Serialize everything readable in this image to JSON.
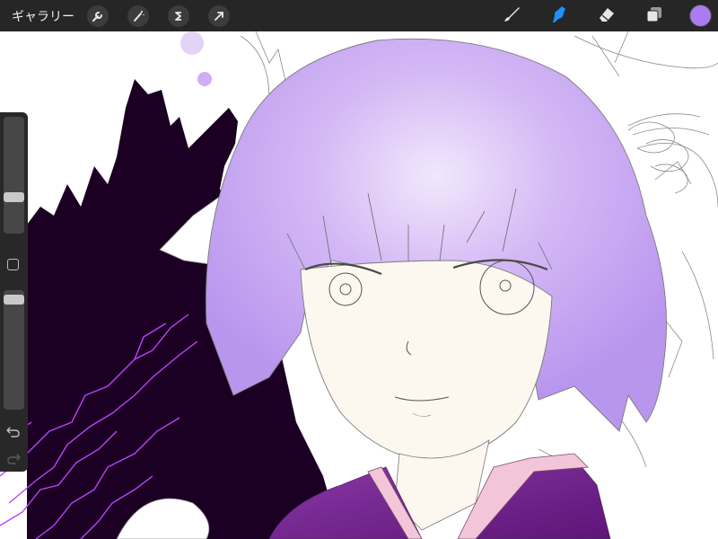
{
  "toolbar": {
    "gallery_label": "ギャラリー",
    "actions": [
      {
        "name": "wrench-icon",
        "meaning": "actions"
      },
      {
        "name": "magic-wand-icon",
        "meaning": "adjustments"
      },
      {
        "name": "selection-s-icon",
        "meaning": "selection"
      },
      {
        "name": "transform-arrow-icon",
        "meaning": "transform"
      }
    ],
    "tools": [
      {
        "name": "brush-icon",
        "active": false
      },
      {
        "name": "smudge-icon",
        "active": true
      },
      {
        "name": "eraser-icon",
        "active": false
      },
      {
        "name": "layers-icon",
        "active": false
      }
    ],
    "current_color": "#a97cf0",
    "active_tool_color": "#1e90ff"
  },
  "sidebar": {
    "brush_size_level": 0.75,
    "opacity_level": 0.0,
    "icons": [
      "square-modify-icon",
      "undo-icon",
      "redo-icon"
    ]
  },
  "canvas": {
    "background_color": "#ffffff",
    "dark_shape_color": "#1b0023",
    "lightning_color": "#c040ff",
    "hair_color": "#c7a7f2",
    "skin_color": "#fdf8ef",
    "kimono_color": "#7a2596",
    "collar_color": "#f2c6d8",
    "dot_color": "#d8b8f5"
  }
}
